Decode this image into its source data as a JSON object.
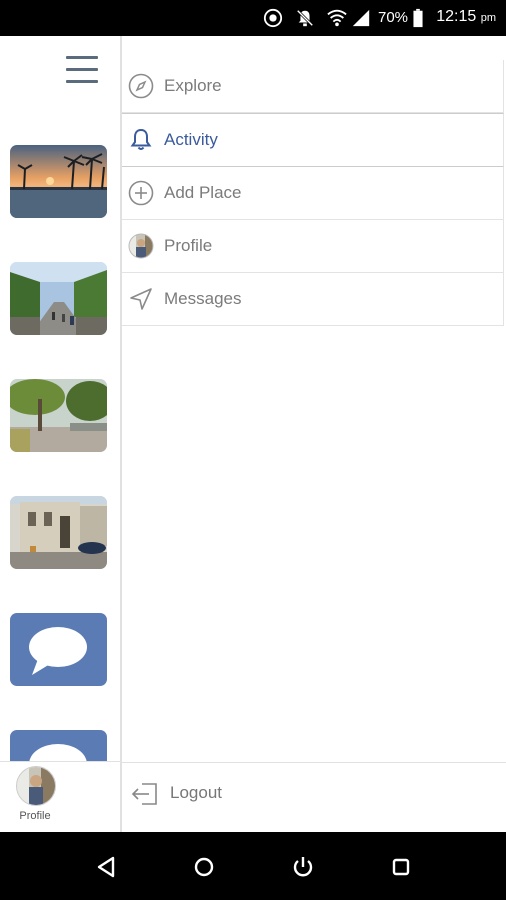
{
  "status_bar": {
    "battery": "70%",
    "time": "12:15",
    "time_suffix": "pm",
    "icons": [
      "sync-icon",
      "notifications-off-icon",
      "wifi-icon",
      "signal-icon",
      "battery-icon"
    ]
  },
  "rail": {
    "menu_icon": "hamburger-menu-icon",
    "thumbnails": [
      "sunset-pool-photo",
      "tree-lined-street-photo",
      "park-trees-photo",
      "building-street-photo",
      "chat-bubble-thumbnail",
      "chat-bubble-thumbnail"
    ],
    "profile_label": "Profile"
  },
  "menu": {
    "items": [
      {
        "label": "Explore",
        "icon": "compass-icon",
        "active": false
      },
      {
        "label": "Activity",
        "icon": "bell-icon",
        "active": true
      },
      {
        "label": "Add Place",
        "icon": "plus-circle-icon",
        "active": false
      },
      {
        "label": "Profile",
        "icon": "avatar-icon",
        "active": false
      },
      {
        "label": "Messages",
        "icon": "send-icon",
        "active": false
      }
    ],
    "logout_label": "Logout",
    "logout_icon": "logout-icon"
  },
  "colors": {
    "accent": "#3a5b9c",
    "inactive_text": "#7b7b7b",
    "chat_tile": "#5a7bb4"
  },
  "nav_bar": {
    "buttons": [
      "back-icon",
      "home-icon",
      "power-icon",
      "recents-icon"
    ]
  }
}
